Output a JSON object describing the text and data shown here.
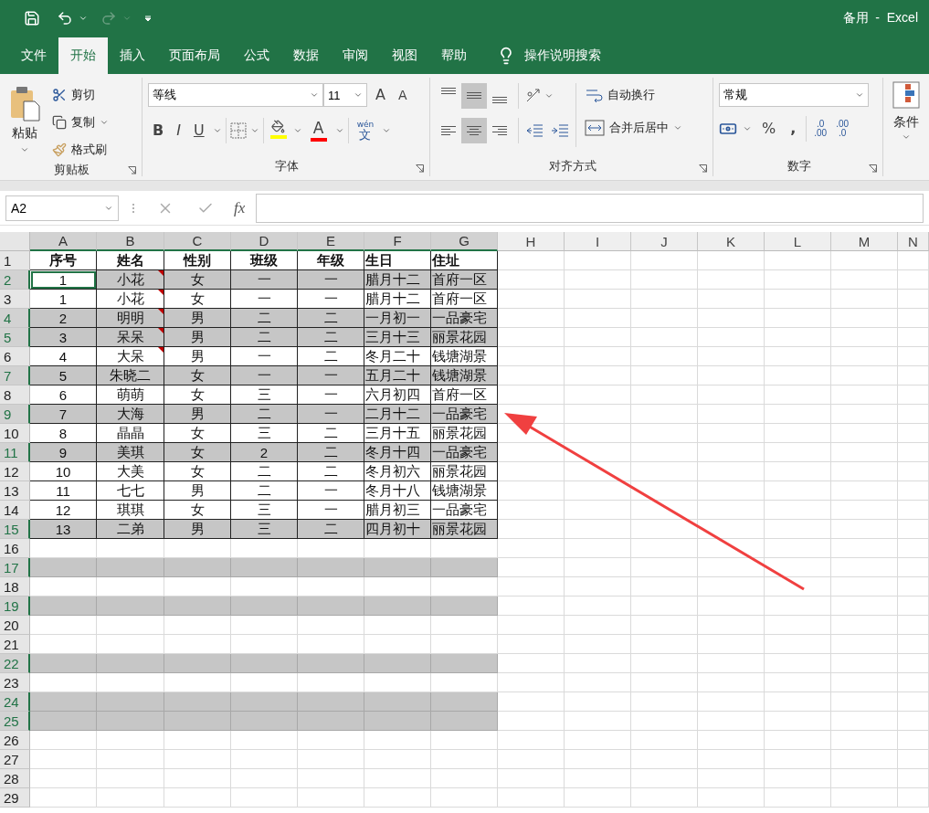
{
  "window": {
    "title": "备用  -  Excel"
  },
  "quick_access": {
    "redo_disabled": true
  },
  "tabs": [
    {
      "label": "文件",
      "selected": false
    },
    {
      "label": "开始",
      "selected": true
    },
    {
      "label": "插入",
      "selected": false
    },
    {
      "label": "页面布局",
      "selected": false
    },
    {
      "label": "公式",
      "selected": false
    },
    {
      "label": "数据",
      "selected": false
    },
    {
      "label": "审阅",
      "selected": false
    },
    {
      "label": "视图",
      "selected": false
    },
    {
      "label": "帮助",
      "selected": false
    }
  ],
  "tell_me": "操作说明搜索",
  "ribbon": {
    "clipboard": {
      "label": "剪贴板",
      "paste": "粘贴",
      "cut": "剪切",
      "copy": "复制",
      "format_painter": "格式刷"
    },
    "font": {
      "label": "字体",
      "font_name": "等线",
      "font_size": "11",
      "grow": "A",
      "shrink": "A",
      "bold": "B",
      "italic": "I",
      "underline": "U",
      "font_color": "A",
      "phonetic_top": "wén",
      "phonetic": "文"
    },
    "alignment": {
      "label": "对齐方式",
      "wrap": "自动换行",
      "merge": "合并后居中",
      "vertical_align": [
        {
          "kind": "top",
          "selected": false
        },
        {
          "kind": "middle",
          "selected": true
        },
        {
          "kind": "bottom",
          "selected": false
        }
      ],
      "horizontal_align": [
        {
          "kind": "left",
          "selected": false
        },
        {
          "kind": "center",
          "selected": true
        },
        {
          "kind": "right",
          "selected": false
        }
      ]
    },
    "number": {
      "label": "数字",
      "format": "常规",
      "percent": "%",
      "comma": ",",
      "increase_decimal": {
        "top": ".0",
        "bottom": ".00"
      },
      "decrease_decimal": {
        "top": ".00",
        "bottom": ".0"
      }
    },
    "styles": {
      "conditional": "条件"
    }
  },
  "formula_bar": {
    "name_box": "A2",
    "fx": "fx"
  },
  "columns": [
    {
      "label": "A",
      "selected": true
    },
    {
      "label": "B",
      "selected": true
    },
    {
      "label": "C",
      "selected": true
    },
    {
      "label": "D",
      "selected": true
    },
    {
      "label": "E",
      "selected": true
    },
    {
      "label": "F",
      "selected": true
    },
    {
      "label": "G",
      "selected": true
    },
    {
      "label": "H",
      "selected": false
    },
    {
      "label": "I",
      "selected": false
    },
    {
      "label": "J",
      "selected": false
    },
    {
      "label": "K",
      "selected": false
    },
    {
      "label": "L",
      "selected": false
    },
    {
      "label": "M",
      "selected": false
    },
    {
      "label": "N",
      "selected": false
    }
  ],
  "rows": [
    {
      "number": "1",
      "kind": "header",
      "selected": false,
      "cells": [
        {
          "text": "序号",
          "comment": false,
          "active": false
        },
        {
          "text": "姓名",
          "comment": false,
          "active": false
        },
        {
          "text": "性别",
          "comment": false,
          "active": false
        },
        {
          "text": "班级",
          "comment": false,
          "active": false
        },
        {
          "text": "年级",
          "comment": false,
          "active": false
        },
        {
          "text": "生日",
          "comment": false,
          "active": false
        },
        {
          "text": "住址",
          "comment": false,
          "active": false
        }
      ]
    },
    {
      "number": "2",
      "kind": "data",
      "selected": true,
      "cells": [
        {
          "text": "1",
          "comment": false,
          "active": true
        },
        {
          "text": "小花",
          "comment": true,
          "active": false
        },
        {
          "text": "女",
          "comment": false,
          "active": false
        },
        {
          "text": "一",
          "comment": false,
          "active": false
        },
        {
          "text": "一",
          "comment": false,
          "active": false
        },
        {
          "text": "腊月十二",
          "comment": false,
          "active": false
        },
        {
          "text": "首府一区",
          "comment": false,
          "active": false
        }
      ]
    },
    {
      "number": "3",
      "kind": "data",
      "selected": false,
      "cells": [
        {
          "text": "1",
          "comment": false,
          "active": false
        },
        {
          "text": "小花",
          "comment": true,
          "active": false
        },
        {
          "text": "女",
          "comment": false,
          "active": false
        },
        {
          "text": "一",
          "comment": false,
          "active": false
        },
        {
          "text": "一",
          "comment": false,
          "active": false
        },
        {
          "text": "腊月十二",
          "comment": false,
          "active": false
        },
        {
          "text": "首府一区",
          "comment": false,
          "active": false
        }
      ]
    },
    {
      "number": "4",
      "kind": "data",
      "selected": true,
      "cells": [
        {
          "text": "2",
          "comment": false,
          "active": false
        },
        {
          "text": "明明",
          "comment": true,
          "active": false
        },
        {
          "text": "男",
          "comment": false,
          "active": false
        },
        {
          "text": "二",
          "comment": false,
          "active": false
        },
        {
          "text": "二",
          "comment": false,
          "active": false
        },
        {
          "text": "一月初一",
          "comment": false,
          "active": false
        },
        {
          "text": "一品豪宅",
          "comment": false,
          "active": false
        }
      ]
    },
    {
      "number": "5",
      "kind": "data",
      "selected": true,
      "cells": [
        {
          "text": "3",
          "comment": false,
          "active": false
        },
        {
          "text": "呆呆",
          "comment": true,
          "active": false
        },
        {
          "text": "男",
          "comment": false,
          "active": false
        },
        {
          "text": "二",
          "comment": false,
          "active": false
        },
        {
          "text": "二",
          "comment": false,
          "active": false
        },
        {
          "text": "三月十三",
          "comment": false,
          "active": false
        },
        {
          "text": "丽景花园",
          "comment": false,
          "active": false
        }
      ]
    },
    {
      "number": "6",
      "kind": "data",
      "selected": false,
      "cells": [
        {
          "text": "4",
          "comment": false,
          "active": false
        },
        {
          "text": "大呆",
          "comment": true,
          "active": false
        },
        {
          "text": "男",
          "comment": false,
          "active": false
        },
        {
          "text": "一",
          "comment": false,
          "active": false
        },
        {
          "text": "二",
          "comment": false,
          "active": false
        },
        {
          "text": "冬月二十",
          "comment": false,
          "active": false
        },
        {
          "text": "钱塘湖景",
          "comment": false,
          "active": false
        }
      ]
    },
    {
      "number": "7",
      "kind": "data",
      "selected": true,
      "cells": [
        {
          "text": "5",
          "comment": false,
          "active": false
        },
        {
          "text": "朱晓二",
          "comment": false,
          "active": false
        },
        {
          "text": "女",
          "comment": false,
          "active": false
        },
        {
          "text": "一",
          "comment": false,
          "active": false
        },
        {
          "text": "一",
          "comment": false,
          "active": false
        },
        {
          "text": "五月二十",
          "comment": false,
          "active": false
        },
        {
          "text": "钱塘湖景",
          "comment": false,
          "active": false
        }
      ]
    },
    {
      "number": "8",
      "kind": "data",
      "selected": false,
      "cells": [
        {
          "text": "6",
          "comment": false,
          "active": false
        },
        {
          "text": "萌萌",
          "comment": false,
          "active": false
        },
        {
          "text": "女",
          "comment": false,
          "active": false
        },
        {
          "text": "三",
          "comment": false,
          "active": false
        },
        {
          "text": "一",
          "comment": false,
          "active": false
        },
        {
          "text": "六月初四",
          "comment": false,
          "active": false
        },
        {
          "text": "首府一区",
          "comment": false,
          "active": false
        }
      ]
    },
    {
      "number": "9",
      "kind": "data",
      "selected": true,
      "cells": [
        {
          "text": "7",
          "comment": false,
          "active": false
        },
        {
          "text": "大海",
          "comment": false,
          "active": false
        },
        {
          "text": "男",
          "comment": false,
          "active": false
        },
        {
          "text": "二",
          "comment": false,
          "active": false
        },
        {
          "text": "一",
          "comment": false,
          "active": false
        },
        {
          "text": "二月十二",
          "comment": false,
          "active": false
        },
        {
          "text": "一品豪宅",
          "comment": false,
          "active": false
        }
      ]
    },
    {
      "number": "10",
      "kind": "data",
      "selected": false,
      "cells": [
        {
          "text": "8",
          "comment": false,
          "active": false
        },
        {
          "text": "晶晶",
          "comment": false,
          "active": false
        },
        {
          "text": "女",
          "comment": false,
          "active": false
        },
        {
          "text": "三",
          "comment": false,
          "active": false
        },
        {
          "text": "二",
          "comment": false,
          "active": false
        },
        {
          "text": "三月十五",
          "comment": false,
          "active": false
        },
        {
          "text": "丽景花园",
          "comment": false,
          "active": false
        }
      ]
    },
    {
      "number": "11",
      "kind": "data",
      "selected": true,
      "cells": [
        {
          "text": "9",
          "comment": false,
          "active": false
        },
        {
          "text": "美琪",
          "comment": false,
          "active": false
        },
        {
          "text": "女",
          "comment": false,
          "active": false
        },
        {
          "text": "2",
          "comment": false,
          "active": false
        },
        {
          "text": "二",
          "comment": false,
          "active": false
        },
        {
          "text": "冬月十四",
          "comment": false,
          "active": false
        },
        {
          "text": "一品豪宅",
          "comment": false,
          "active": false
        }
      ]
    },
    {
      "number": "12",
      "kind": "data",
      "selected": false,
      "cells": [
        {
          "text": "10",
          "comment": false,
          "active": false
        },
        {
          "text": "大美",
          "comment": false,
          "active": false
        },
        {
          "text": "女",
          "comment": false,
          "active": false
        },
        {
          "text": "二",
          "comment": false,
          "active": false
        },
        {
          "text": "二",
          "comment": false,
          "active": false
        },
        {
          "text": "冬月初六",
          "comment": false,
          "active": false
        },
        {
          "text": "丽景花园",
          "comment": false,
          "active": false
        }
      ]
    },
    {
      "number": "13",
      "kind": "data",
      "selected": false,
      "cells": [
        {
          "text": "11",
          "comment": false,
          "active": false
        },
        {
          "text": "七七",
          "comment": false,
          "active": false
        },
        {
          "text": "男",
          "comment": false,
          "active": false
        },
        {
          "text": "二",
          "comment": false,
          "active": false
        },
        {
          "text": "一",
          "comment": false,
          "active": false
        },
        {
          "text": "冬月十八",
          "comment": false,
          "active": false
        },
        {
          "text": "钱塘湖景",
          "comment": false,
          "active": false
        }
      ]
    },
    {
      "number": "14",
      "kind": "data",
      "selected": false,
      "cells": [
        {
          "text": "12",
          "comment": false,
          "active": false
        },
        {
          "text": "琪琪",
          "comment": false,
          "active": false
        },
        {
          "text": "女",
          "comment": false,
          "active": false
        },
        {
          "text": "三",
          "comment": false,
          "active": false
        },
        {
          "text": "一",
          "comment": false,
          "active": false
        },
        {
          "text": "腊月初三",
          "comment": false,
          "active": false
        },
        {
          "text": "一品豪宅",
          "comment": false,
          "active": false
        }
      ]
    },
    {
      "number": "15",
      "kind": "data",
      "selected": true,
      "cells": [
        {
          "text": "13",
          "comment": false,
          "active": false
        },
        {
          "text": "二弟",
          "comment": false,
          "active": false
        },
        {
          "text": "男",
          "comment": false,
          "active": false
        },
        {
          "text": "三",
          "comment": false,
          "active": false
        },
        {
          "text": "二",
          "comment": false,
          "active": false
        },
        {
          "text": "四月初十",
          "comment": false,
          "active": false
        },
        {
          "text": "丽景花园",
          "comment": false,
          "active": false
        }
      ]
    },
    {
      "number": "16",
      "selected": false
    },
    {
      "number": "17",
      "selected": true
    },
    {
      "number": "18",
      "selected": false
    },
    {
      "number": "19",
      "selected": true
    },
    {
      "number": "20",
      "selected": false
    },
    {
      "number": "21",
      "selected": false
    },
    {
      "number": "22",
      "selected": true
    },
    {
      "number": "23",
      "selected": false
    },
    {
      "number": "24",
      "selected": true
    },
    {
      "number": "25",
      "selected": true
    },
    {
      "number": "26",
      "selected": false
    },
    {
      "number": "27",
      "selected": false
    },
    {
      "number": "28",
      "selected": false
    },
    {
      "number": "29",
      "selected": false
    }
  ]
}
